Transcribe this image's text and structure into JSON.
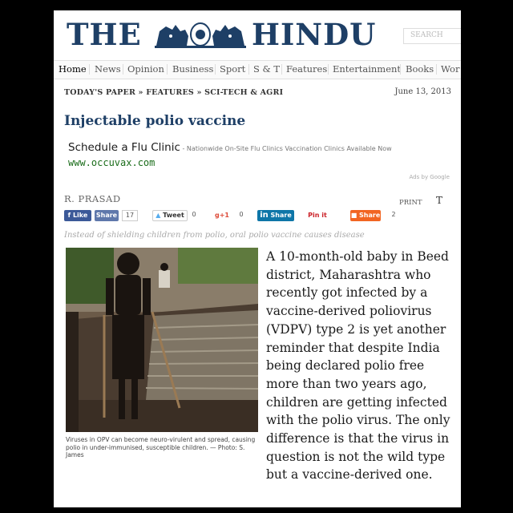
{
  "masthead": {
    "the": "THE",
    "hindu": "HINDU",
    "search_label": "SEARCH"
  },
  "nav": {
    "items": [
      "Home",
      "News",
      "Opinion",
      "Business",
      "Sport",
      "S & T",
      "Features",
      "Entertainment",
      "Books",
      "Wor"
    ]
  },
  "breadcrumb": "TODAY'S PAPER » FEATURES » SCI-TECH & AGRI",
  "date": "June 13, 2013",
  "headline": "Injectable polio vaccine",
  "ad": {
    "title": "Schedule a Flu Clinic",
    "separator": " - ",
    "description": "Nationwide On-Site Flu Clinics Vaccination Clinics Available Now",
    "url": "www.occuvax.com",
    "ads_by": "Ads by Google"
  },
  "byline": "R. PRASAD",
  "tools": {
    "print": "PRINT",
    "font": "T"
  },
  "share": {
    "like": "Like",
    "fb_share": "Share",
    "fb_count": "17",
    "tweet": "Tweet",
    "tweet_count": "0",
    "gplus": "g+1",
    "gplus_count": "0",
    "linkedin": "Share",
    "linkedin_logo": "in",
    "pinit": "Pin it",
    "share": "Share",
    "share_count": "2"
  },
  "subheading": "Instead of shielding children from polio, oral polio vaccine causes disease",
  "photo_caption": "Viruses in OPV can become neuro-virulent and spread, causing polio in under-immunised, susceptible children. — Photo: S. James",
  "body": "A 10-month-old baby in Beed district, Maharashtra who recently got infected by a vaccine-derived poliovirus (VDPV) type 2 is yet another reminder that despite India being declared polio free more than two years ago, children are getting infected with the polio virus. The only difference is that the virus in question is not the wild type but a vaccine-derived one.",
  "colors": {
    "brand_blue": "#1e3f66",
    "ad_url_green": "#1b6d1b",
    "facebook": "#3b5998",
    "linkedin": "#0e76a8",
    "share_orange": "#f26522"
  }
}
